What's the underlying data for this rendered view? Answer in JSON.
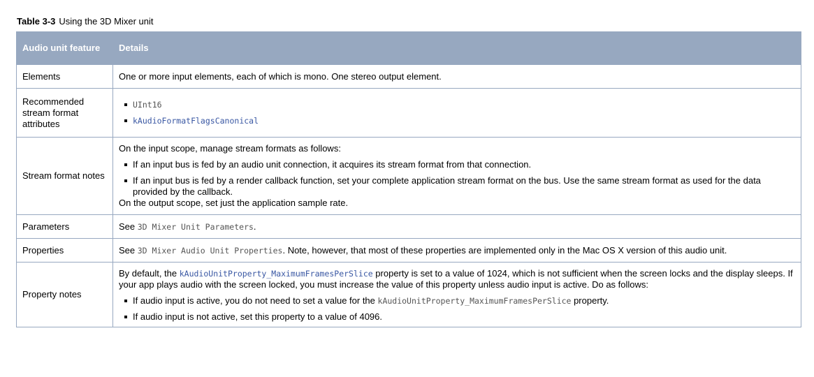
{
  "caption": {
    "number": "Table 3-3",
    "title": "Using the 3D Mixer unit"
  },
  "table": {
    "headers": {
      "feature": "Audio unit feature",
      "details": "Details"
    },
    "rows": {
      "elements": {
        "feature": "Elements",
        "text": "One or more input elements, each of which is mono. One stereo output element."
      },
      "recommended": {
        "feature": "Recommended stream format attributes",
        "items": [
          "UInt16",
          "kAudioFormatFlagsCanonical"
        ]
      },
      "stream_notes": {
        "feature": "Stream format notes",
        "intro": "On the input scope, manage stream formats as follows:",
        "items": [
          "If an input bus is fed by an audio unit connection, it acquires its stream format from that connection.",
          "If an input bus is fed by a render callback function, set your complete application stream format on the bus. Use the same stream format as used for the data provided by the callback."
        ],
        "outro": "On the output scope, set just the application sample rate."
      },
      "parameters": {
        "feature": "Parameters",
        "prefix": "See ",
        "link": "3D Mixer Unit Parameters",
        "suffix": "."
      },
      "properties": {
        "feature": "Properties",
        "prefix": "See ",
        "link": "3D Mixer Audio Unit Properties",
        "suffix": ". Note, however, that most of these properties are implemented only in the Mac OS X version of this audio unit."
      },
      "property_notes": {
        "feature": "Property notes",
        "p_prefix": "By default, the ",
        "p_code": "kAudioUnitProperty_MaximumFramesPerSlice",
        "p_suffix": " property is set to a value of 1024, which is not sufficient when the screen locks and the display sleeps. If your app plays audio with the screen locked, you must increase the value of this property unless audio input is active. Do as follows:",
        "item1_prefix": "If audio input is active, you do not need to set a value for the ",
        "item1_code": "kAudioUnitProperty_MaximumFramesPerSlice",
        "item1_suffix": " property.",
        "item2": "If audio input is not active, set this property to a value of 4096."
      }
    }
  }
}
